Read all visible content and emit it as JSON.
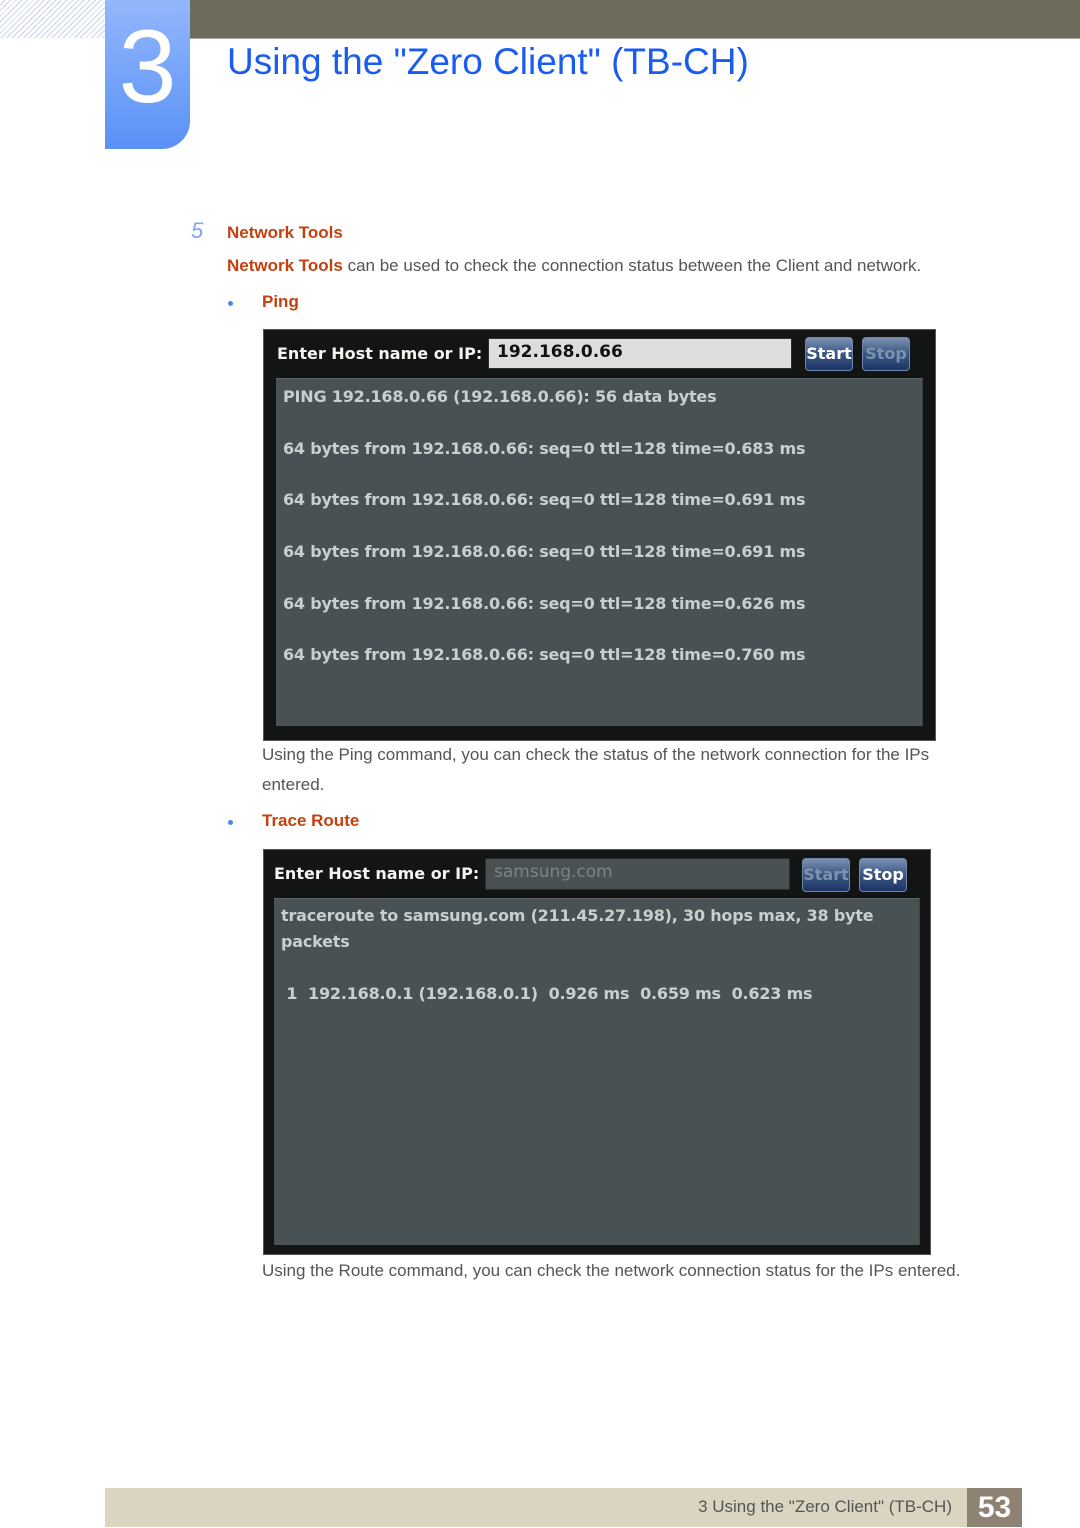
{
  "header": {
    "chapter_number": "3",
    "title": "Using the \"Zero Client\" (TB-CH)"
  },
  "section": {
    "number": "5",
    "title": "Network Tools",
    "intro_highlight": "Network Tools",
    "intro_rest": " can be used to check the connection status between the Client and network."
  },
  "ping": {
    "heading": "Ping",
    "host_label": "Enter Host name or IP:",
    "host_value": "192.168.0.66",
    "start_label": "Start",
    "stop_label": "Stop",
    "start_enabled": true,
    "stop_enabled": false,
    "output_lines": [
      "PING 192.168.0.66 (192.168.0.66): 56 data bytes",
      "64 bytes from 192.168.0.66: seq=0 ttl=128 time=0.683 ms",
      "64 bytes from 192.168.0.66: seq=0 ttl=128 time=0.691 ms",
      "64 bytes from 192.168.0.66: seq=0 ttl=128 time=0.691 ms",
      "64 bytes from 192.168.0.66: seq=0 ttl=128 time=0.626 ms",
      "64 bytes from 192.168.0.66: seq=0 ttl=128 time=0.760 ms"
    ],
    "caption_line1": "Using the Ping command, you can check the status of the network connection for the IPs",
    "caption_line2": "entered."
  },
  "traceroute": {
    "heading": "Trace Route",
    "host_label": "Enter Host name or IP:",
    "host_value": "samsung.com",
    "start_label": "Start",
    "stop_label": "Stop",
    "start_enabled": false,
    "stop_enabled": true,
    "output_lines": [
      "traceroute to samsung.com (211.45.27.198), 30 hops max, 38 byte",
      "packets",
      " 1  192.168.0.1 (192.168.0.1)  0.926 ms  0.659 ms  0.623 ms"
    ],
    "caption": "Using the Route command, you can check the network connection status for the IPs entered."
  },
  "footer": {
    "text": "3 Using the \"Zero Client\" (TB-CH)",
    "page_number": "53"
  }
}
